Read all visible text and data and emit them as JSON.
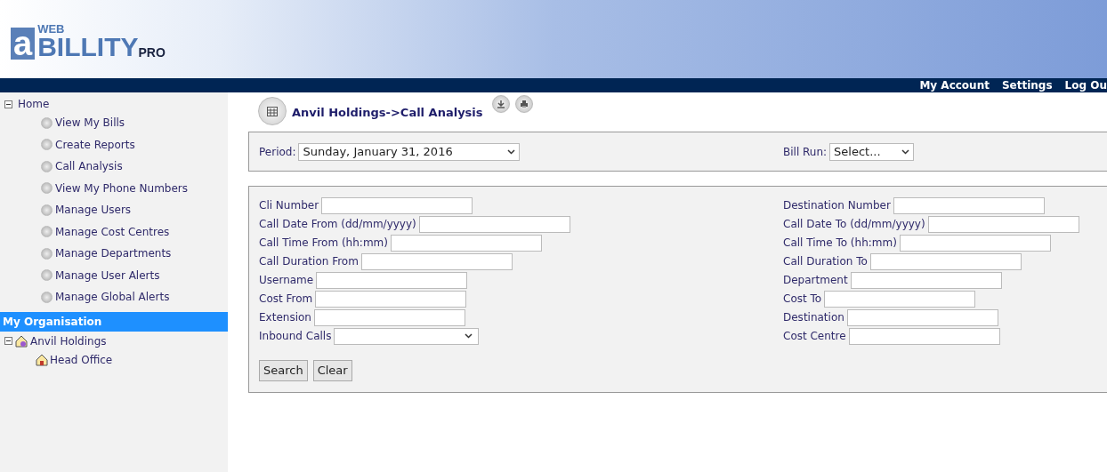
{
  "logo": {
    "mark": "a",
    "web": "WEB",
    "name": "BILLITY",
    "edition": "PRO"
  },
  "top_nav": [
    "My Account",
    "Settings",
    "Log Ou"
  ],
  "sidebar": {
    "tree": [
      {
        "label": "Home",
        "expanded": true,
        "children": [
          {
            "label": "View My Bills"
          },
          {
            "label": "Create Reports"
          },
          {
            "label": "Call Analysis"
          },
          {
            "label": "View My Phone Numbers"
          },
          {
            "label": "Manage Users"
          },
          {
            "label": "Manage Cost Centres"
          },
          {
            "label": "Manage Departments"
          },
          {
            "label": "Manage User Alerts"
          },
          {
            "label": "Manage Global Alerts"
          }
        ]
      }
    ],
    "section_title": "My Organisation",
    "org_tree": [
      {
        "label": "Anvil Holdings",
        "expanded": true,
        "children": [
          {
            "label": "Head Office"
          }
        ]
      }
    ]
  },
  "page_title": "Anvil Holdings->Call Analysis",
  "period": {
    "label": "Period:",
    "value": "Sunday, January 31, 2016"
  },
  "bill_run": {
    "label": "Bill Run:",
    "value": "Select..."
  },
  "left_fields": [
    {
      "label": "Cli Number",
      "kind": "text"
    },
    {
      "label": "Call Date From (dd/mm/yyyy)",
      "kind": "text"
    },
    {
      "label": "Call Time From (hh:mm)",
      "kind": "text"
    },
    {
      "label": "Call Duration From",
      "kind": "text"
    },
    {
      "label": "Username",
      "kind": "text"
    },
    {
      "label": "Cost From",
      "kind": "text"
    },
    {
      "label": "Extension",
      "kind": "text"
    },
    {
      "label": "Inbound Calls",
      "kind": "select"
    }
  ],
  "right_fields": [
    {
      "label": "Destination Number",
      "kind": "text"
    },
    {
      "label": "Call Date To (dd/mm/yyyy)",
      "kind": "text"
    },
    {
      "label": "Call Time To (hh:mm)",
      "kind": "text"
    },
    {
      "label": "Call Duration To",
      "kind": "text"
    },
    {
      "label": "Department",
      "kind": "text"
    },
    {
      "label": "Cost To",
      "kind": "text"
    },
    {
      "label": "Destination",
      "kind": "text"
    },
    {
      "label": "Cost Centre",
      "kind": "text"
    }
  ],
  "buttons": [
    "Search",
    "Clear"
  ]
}
